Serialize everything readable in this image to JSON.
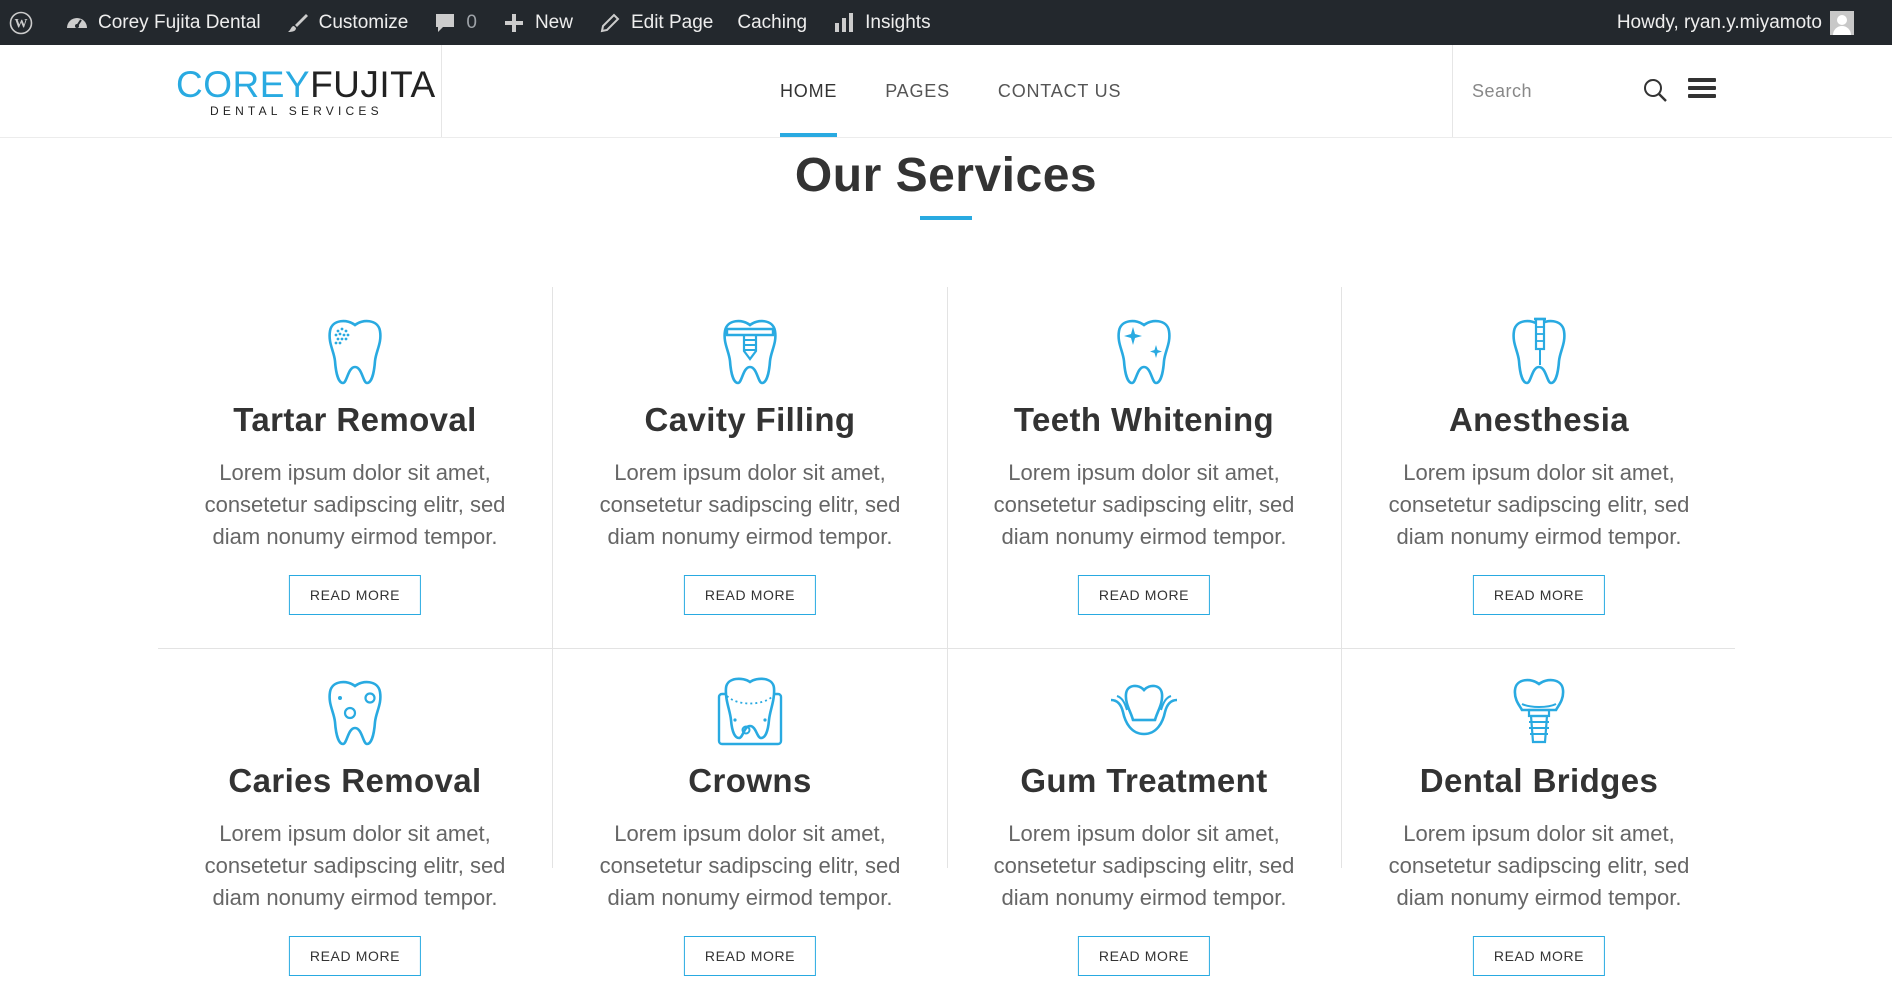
{
  "admin_bar": {
    "site_name": "Corey Fujita Dental",
    "customize": "Customize",
    "comments_count": "0",
    "new": "New",
    "edit_page": "Edit Page",
    "caching": "Caching",
    "insights": "Insights",
    "howdy": "Howdy, ryan.y.miyamoto"
  },
  "header": {
    "logo_part1": "COREY",
    "logo_part2": "FUJITA",
    "logo_sub": "DENTAL SERVICES",
    "nav": [
      "HOME",
      "PAGES",
      "CONTACT US"
    ],
    "search_placeholder": "Search"
  },
  "section": {
    "title": "Our Services"
  },
  "services": [
    {
      "title": "Tartar Removal",
      "text": "Lorem ipsum dolor sit amet, consetetur sadipscing elitr, sed diam nonumy eirmod tempor.",
      "button": "READ MORE",
      "icon": "tooth-tartar-icon"
    },
    {
      "title": "Cavity Filling",
      "text": "Lorem ipsum dolor sit amet, consetetur sadipscing elitr, sed diam nonumy eirmod tempor.",
      "button": "READ MORE",
      "icon": "tooth-filling-icon"
    },
    {
      "title": "Teeth Whitening",
      "text": "Lorem ipsum dolor sit amet, consetetur sadipscing elitr, sed diam nonumy eirmod tempor.",
      "button": "READ MORE",
      "icon": "tooth-sparkle-icon"
    },
    {
      "title": "Anesthesia",
      "text": "Lorem ipsum dolor sit amet, consetetur sadipscing elitr, sed diam nonumy eirmod tempor.",
      "button": "READ MORE",
      "icon": "tooth-syringe-icon"
    },
    {
      "title": "Caries Removal",
      "text": "Lorem ipsum dolor sit amet, consetetur sadipscing elitr, sed diam nonumy eirmod tempor.",
      "button": "READ MORE",
      "icon": "tooth-caries-icon"
    },
    {
      "title": "Crowns",
      "text": "Lorem ipsum dolor sit amet, consetetur sadipscing elitr, sed diam nonumy eirmod tempor.",
      "button": "READ MORE",
      "icon": "tooth-crown-icon"
    },
    {
      "title": "Gum Treatment",
      "text": "Lorem ipsum dolor sit amet, consetetur sadipscing elitr, sed diam nonumy eirmod tempor.",
      "button": "READ MORE",
      "icon": "tooth-gum-icon"
    },
    {
      "title": "Dental Bridges",
      "text": "Lorem ipsum dolor sit amet, consetetur sadipscing elitr, sed diam nonumy eirmod tempor.",
      "button": "READ MORE",
      "icon": "tooth-implant-icon"
    }
  ],
  "colors": {
    "accent": "#29aae1",
    "admin_bar": "#23282d"
  }
}
